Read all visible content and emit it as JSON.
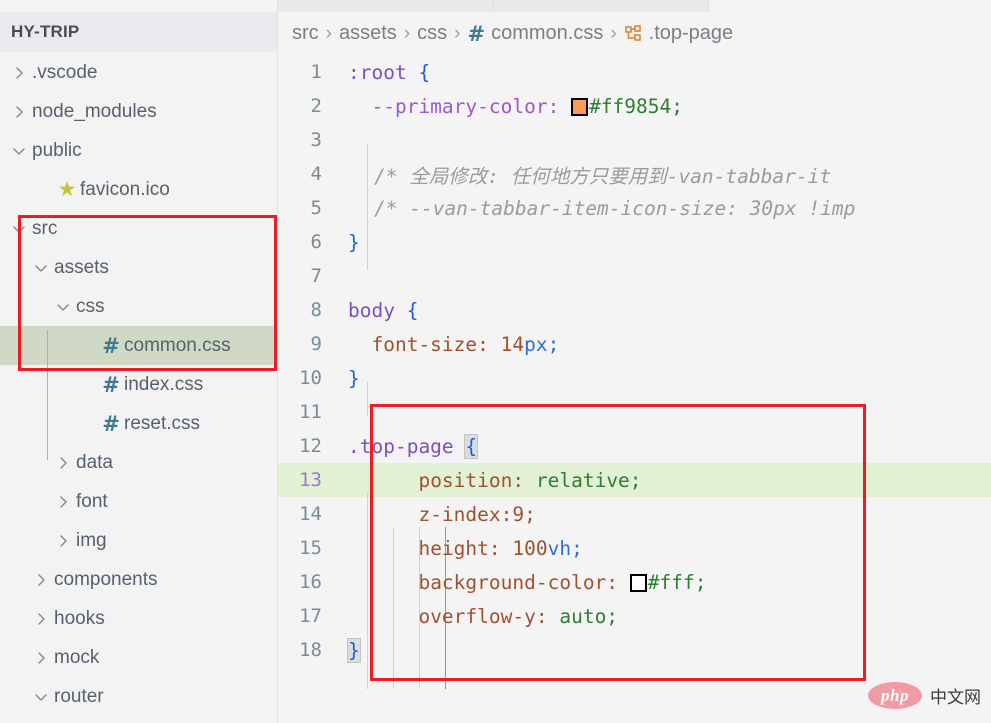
{
  "sidebar": {
    "title": "HY-TRIP",
    "items": [
      {
        "label": ".vscode",
        "indent": 0,
        "twist": "chevron-right",
        "icon": "none",
        "selected": false
      },
      {
        "label": "node_modules",
        "indent": 0,
        "twist": "chevron-right",
        "icon": "none",
        "selected": false
      },
      {
        "label": "public",
        "indent": 0,
        "twist": "chevron-down",
        "icon": "none",
        "selected": false
      },
      {
        "label": "favicon.ico",
        "indent": 1,
        "twist": "none",
        "icon": "star",
        "selected": false
      },
      {
        "label": "src",
        "indent": 0,
        "twist": "chevron-down",
        "icon": "none",
        "selected": false
      },
      {
        "label": "assets",
        "indent": 1,
        "twist": "chevron-down",
        "icon": "none",
        "selected": false
      },
      {
        "label": "css",
        "indent": 2,
        "twist": "chevron-down",
        "icon": "none",
        "selected": false
      },
      {
        "label": "common.css",
        "indent": 3,
        "twist": "none",
        "icon": "hash",
        "selected": true
      },
      {
        "label": "index.css",
        "indent": 3,
        "twist": "none",
        "icon": "hash",
        "selected": false
      },
      {
        "label": "reset.css",
        "indent": 3,
        "twist": "none",
        "icon": "hash",
        "selected": false
      },
      {
        "label": "data",
        "indent": 2,
        "twist": "chevron-right",
        "icon": "none",
        "selected": false
      },
      {
        "label": "font",
        "indent": 2,
        "twist": "chevron-right",
        "icon": "none",
        "selected": false
      },
      {
        "label": "img",
        "indent": 2,
        "twist": "chevron-right",
        "icon": "none",
        "selected": false
      },
      {
        "label": "components",
        "indent": 1,
        "twist": "chevron-right",
        "icon": "none",
        "selected": false
      },
      {
        "label": "hooks",
        "indent": 1,
        "twist": "chevron-right",
        "icon": "none",
        "selected": false
      },
      {
        "label": "mock",
        "indent": 1,
        "twist": "chevron-right",
        "icon": "none",
        "selected": false
      },
      {
        "label": "router",
        "indent": 1,
        "twist": "chevron-down",
        "icon": "none",
        "selected": false
      }
    ]
  },
  "breadcrumb": {
    "separator": "›",
    "segments": [
      {
        "label": "src",
        "icon": "none"
      },
      {
        "label": "assets",
        "icon": "none"
      },
      {
        "label": "css",
        "icon": "none"
      },
      {
        "label": "common.css",
        "icon": "hash"
      },
      {
        "label": ".top-page",
        "icon": "css-selector"
      }
    ]
  },
  "editor": {
    "language": "css",
    "active_line": 13,
    "lines": [
      {
        "n": "1",
        "text": ":root {"
      },
      {
        "n": "2",
        "text": "  --primary-color: #ff9854;"
      },
      {
        "n": "3",
        "text": ""
      },
      {
        "n": "4",
        "text": "  /* 全局修改: 任何地方只要用到-van-tabbar-it"
      },
      {
        "n": "5",
        "text": "  /* --van-tabbar-item-icon-size: 30px !imp"
      },
      {
        "n": "6",
        "text": "}"
      },
      {
        "n": "7",
        "text": ""
      },
      {
        "n": "8",
        "text": "body {"
      },
      {
        "n": "9",
        "text": "  font-size: 14px;"
      },
      {
        "n": "10",
        "text": "}"
      },
      {
        "n": "11",
        "text": ""
      },
      {
        "n": "12",
        "text": ".top-page {"
      },
      {
        "n": "13",
        "text": "      position: relative;"
      },
      {
        "n": "14",
        "text": "      z-index:9;"
      },
      {
        "n": "15",
        "text": "      height: 100vh;"
      },
      {
        "n": "16",
        "text": "      background-color: #fff;"
      },
      {
        "n": "17",
        "text": "      overflow-y: auto;"
      },
      {
        "n": "18",
        "text": "}"
      }
    ],
    "tokens": {
      "root_selector": ":root",
      "open_brace": "{",
      "close_brace": "}",
      "primary_color_prop": "--primary-color:",
      "primary_color_value": "#ff9854;",
      "primary_color_hex": "#ff9854",
      "comment_line_4": "/* 全局修改: 任何地方只要用到-van-tabbar-it",
      "comment_line_5": "/* --van-tabbar-item-icon-size: 30px !imp",
      "body_selector": "body",
      "font_size_prop": "font-size:",
      "font_size_num": "14",
      "font_size_unit": "px;",
      "top_page_selector": ".top-page",
      "position_prop": "position:",
      "position_value": "relative;",
      "zindex_prop": "z-index:",
      "zindex_value": "9;",
      "height_prop": "height:",
      "height_num": "100",
      "height_unit": "vh;",
      "bg_prop": "background-color:",
      "bg_value": "#fff;",
      "bg_hex": "#ffffff",
      "overflow_prop": "overflow-y:",
      "overflow_value": "auto;"
    }
  },
  "annotations": {
    "sidebar_highlight_label": "src-assets-css-common-css-group",
    "code_highlight_label": "top-page-rule-block",
    "color": "#ed1c24"
  },
  "watermark": {
    "logo_text": "php",
    "site_text": "中文网"
  }
}
